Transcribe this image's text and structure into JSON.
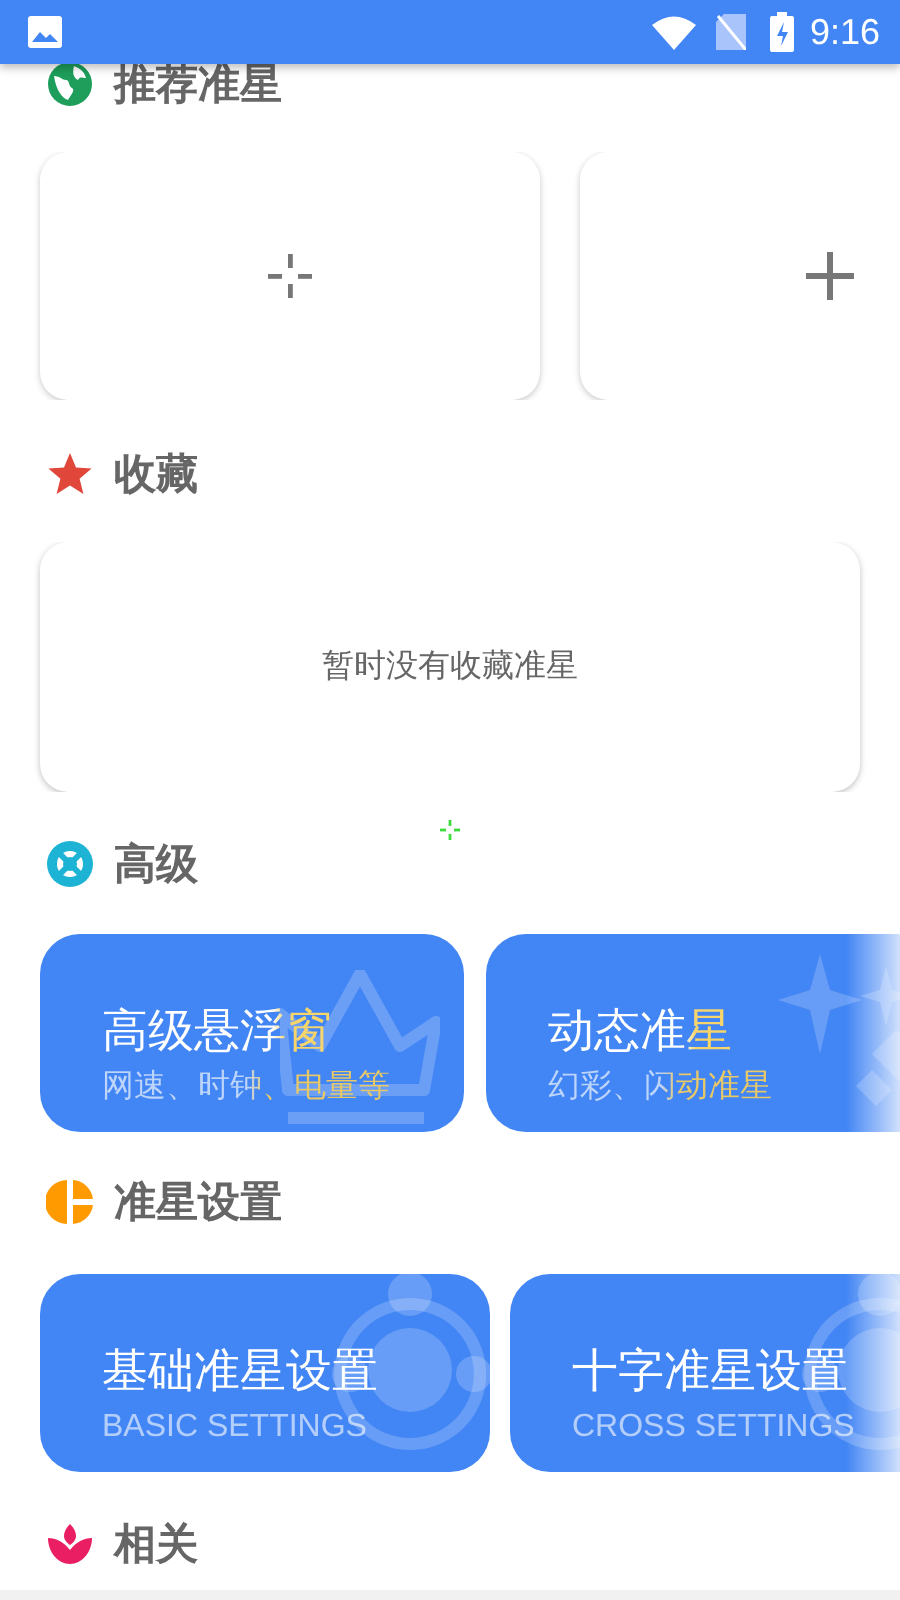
{
  "status_bar": {
    "time": "9:16"
  },
  "sections": [
    {
      "title": "推荐准星",
      "kind": "crosshairs"
    },
    {
      "title": "收藏",
      "kind": "empty",
      "empty_text": "暂时没有收藏准星"
    },
    {
      "title": "高级",
      "kind": "features",
      "cards": [
        {
          "title": "高级悬浮窗",
          "subtitle": "网速、时钟、电量等",
          "highlight": true
        },
        {
          "title": "动态准星",
          "subtitle": "幻彩、闪动准星",
          "highlight": true
        }
      ]
    },
    {
      "title": "准星设置",
      "kind": "features",
      "cards": [
        {
          "title": "基础准星设置",
          "subtitle": "BASIC SETTINGS",
          "highlight": false
        },
        {
          "title": "十字准星设置",
          "subtitle": "CROSS SETTINGS",
          "highlight": false
        }
      ]
    },
    {
      "title": "相关",
      "kind": "heading_only"
    }
  ]
}
